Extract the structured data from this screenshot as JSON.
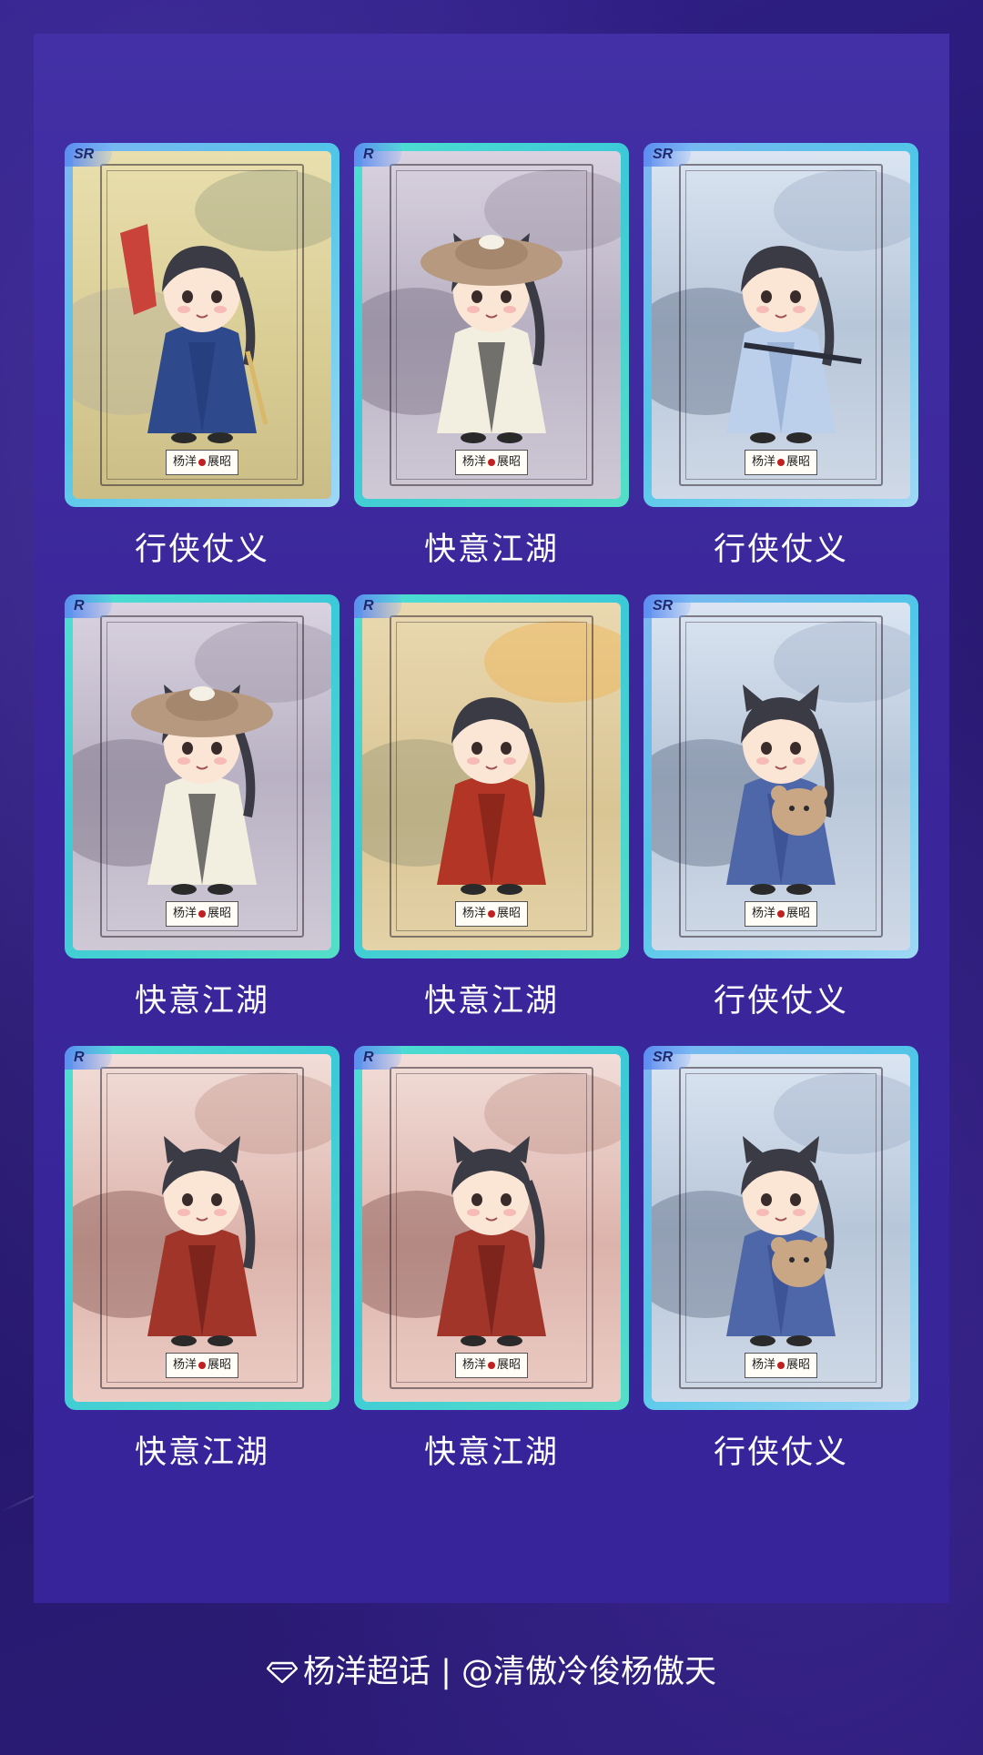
{
  "cards": [
    {
      "rarity": "SR",
      "label": "行侠仗义",
      "logo": "杨洋",
      "logo2": "展昭",
      "theme": "gold",
      "character": "swordsman-with-fan"
    },
    {
      "rarity": "R",
      "label": "快意江湖",
      "logo": "杨洋",
      "logo2": "展昭",
      "theme": "grey",
      "character": "straw-hat-boy"
    },
    {
      "rarity": "SR",
      "label": "行侠仗义",
      "logo": "杨洋",
      "logo2": "展昭",
      "theme": "ice",
      "character": "swordsman-blue"
    },
    {
      "rarity": "R",
      "label": "快意江湖",
      "logo": "杨洋",
      "logo2": "展昭",
      "theme": "grey",
      "character": "straw-hat-boy"
    },
    {
      "rarity": "R",
      "label": "快意江湖",
      "logo": "杨洋",
      "logo2": "展昭",
      "theme": "tan",
      "character": "red-robe-wink"
    },
    {
      "rarity": "SR",
      "label": "行侠仗义",
      "logo": "杨洋",
      "logo2": "展昭",
      "theme": "ice",
      "character": "cat-ear-bear"
    },
    {
      "rarity": "R",
      "label": "快意江湖",
      "logo": "杨洋",
      "logo2": "展昭",
      "theme": "rose",
      "character": "cat-ear-red-robe"
    },
    {
      "rarity": "R",
      "label": "快意江湖",
      "logo": "杨洋",
      "logo2": "展昭",
      "theme": "rose",
      "character": "cat-ear-red-robe"
    },
    {
      "rarity": "SR",
      "label": "行侠仗义",
      "logo": "杨洋",
      "logo2": "展昭",
      "theme": "ice",
      "character": "cat-ear-bear"
    }
  ],
  "footer": {
    "icon": "diamond-icon",
    "text": "杨洋超话 | @清傲冷俊杨傲天"
  }
}
